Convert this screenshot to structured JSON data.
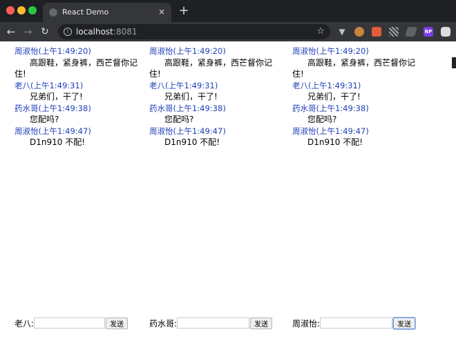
{
  "browser": {
    "tab_title": "React Demo",
    "tab_close": "×",
    "new_tab": "+",
    "url_host": "localhost",
    "url_port": ":8081"
  },
  "chats": [
    {
      "messages": [
        {
          "sender": "周淑怡(上午1:49:20)",
          "text": "高跟鞋，紧身裤，西芒督你记住!"
        },
        {
          "sender": "老八(上午1:49:31)",
          "text": "兄弟们，干了!"
        },
        {
          "sender": "药水哥(上午1:49:38)",
          "text": "您配吗?"
        },
        {
          "sender": "周淑怡(上午1:49:47)",
          "text": "D1n910 不配!"
        }
      ],
      "user_label": "老八:",
      "input_value": "",
      "send_label": "发送"
    },
    {
      "messages": [
        {
          "sender": "周淑怡(上午1:49:20)",
          "text": "高跟鞋，紧身裤，西芒督你记住!"
        },
        {
          "sender": "老八(上午1:49:31)",
          "text": "兄弟们，干了!"
        },
        {
          "sender": "药水哥(上午1:49:38)",
          "text": "您配吗?"
        },
        {
          "sender": "周淑怡(上午1:49:47)",
          "text": "D1n910 不配!"
        }
      ],
      "user_label": "药水哥:",
      "input_value": "",
      "send_label": "发送"
    },
    {
      "messages": [
        {
          "sender": "周淑怡(上午1:49:20)",
          "text": "高跟鞋，紧身裤，西芒督你记住!"
        },
        {
          "sender": "老八(上午1:49:31)",
          "text": "兄弟们，干了!"
        },
        {
          "sender": "药水哥(上午1:49:38)",
          "text": "您配吗?"
        },
        {
          "sender": "周淑怡(上午1:49:47)",
          "text": "D1n910 不配!"
        }
      ],
      "user_label": "周淑怡:",
      "input_value": "",
      "send_label": "发送"
    }
  ],
  "colors": {
    "sender": "#1d3fb8",
    "chrome_dark": "#1f2023",
    "toolbar": "#35363a"
  }
}
